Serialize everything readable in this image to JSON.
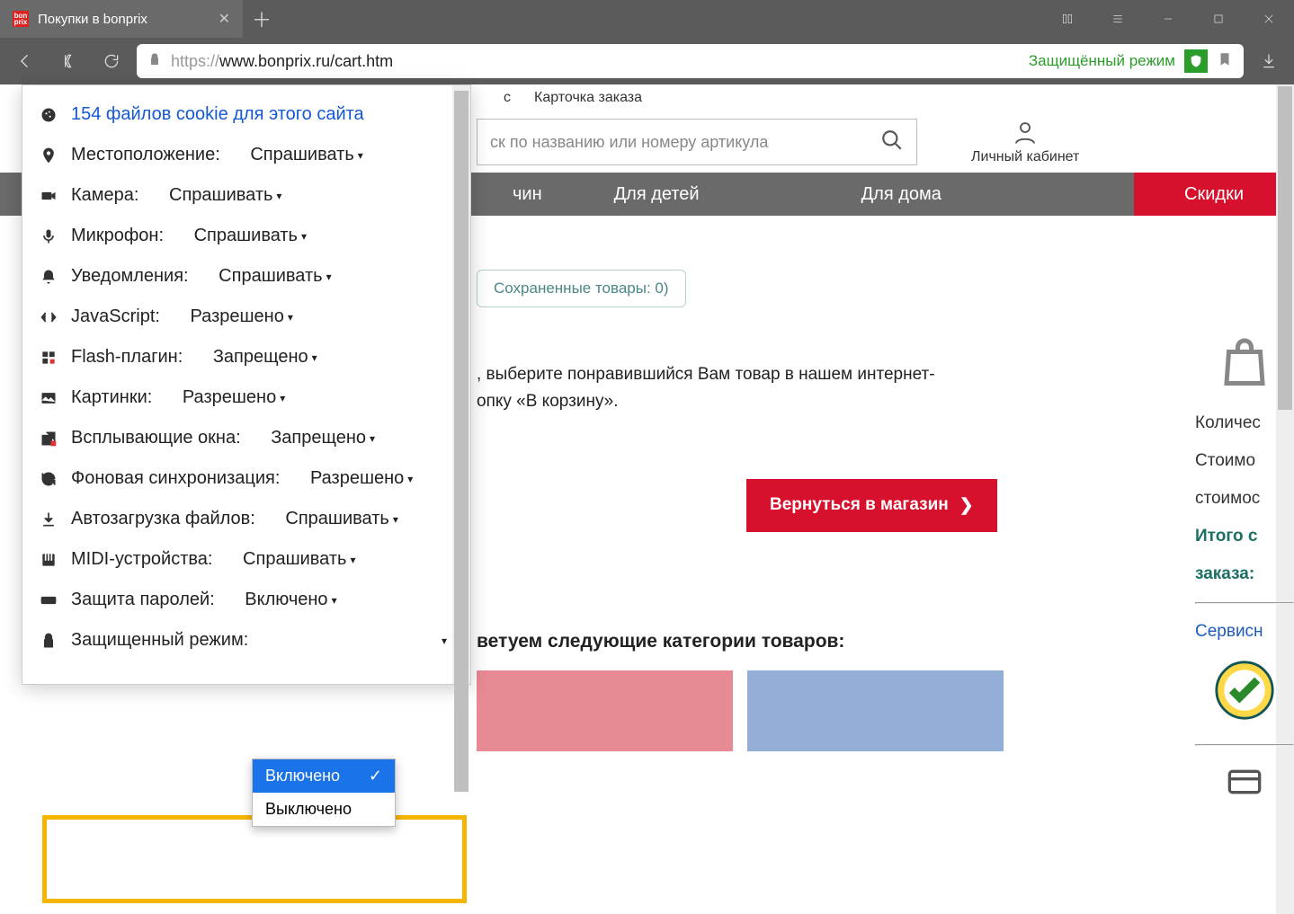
{
  "tab": {
    "title": "Покупки в bonprix"
  },
  "url": {
    "prefix": "https://",
    "rest": "www.bonprix.ru/cart.htm"
  },
  "secure_mode_label": "Защищённый режим",
  "perm": {
    "cookies": "154 файлов cookie для этого сайта",
    "rows": [
      {
        "label": "Местоположение:",
        "value": "Спрашивать"
      },
      {
        "label": "Камера:",
        "value": "Спрашивать"
      },
      {
        "label": "Микрофон:",
        "value": "Спрашивать"
      },
      {
        "label": "Уведомления:",
        "value": "Спрашивать"
      },
      {
        "label": "JavaScript:",
        "value": "Разрешено"
      },
      {
        "label": "Flash-плагин:",
        "value": "Запрещено"
      },
      {
        "label": "Картинки:",
        "value": "Разрешено"
      },
      {
        "label": "Всплывающие окна:",
        "value": "Запрещено"
      },
      {
        "label": "Фоновая синхронизация:",
        "value": "Разрешено"
      },
      {
        "label": "Автозагрузка файлов:",
        "value": "Спрашивать"
      },
      {
        "label": "MIDI-устройства:",
        "value": "Спрашивать"
      },
      {
        "label": "Защита паролей:",
        "value": "Включено"
      },
      {
        "label": "Защищенный режим:",
        "value": ""
      }
    ],
    "menu": {
      "on": "Включено",
      "off": "Выключено"
    }
  },
  "topnav": {
    "a": "с",
    "b": "Карточка заказа"
  },
  "search_placeholder": "ск по названию или номеру артикула",
  "account_label": "Личный кабинет",
  "cats": {
    "a": "чин",
    "b": "Для детей",
    "c": "Для дома",
    "d": "Скидки"
  },
  "saved": "Сохраненные товары: 0)",
  "cart_msg1": ", выберите понравившийся Вам товар в нашем интернет-",
  "cart_msg2": "опку «В корзину».",
  "return_btn": "Вернуться в магазин",
  "rec_title": "ветуем следующие категории товаров:",
  "right": {
    "qty": "Количес",
    "cost": "Стоимо",
    "cost2": "стоимос",
    "total": "Итого с",
    "order": "заказа:",
    "service": "Сервисн"
  }
}
